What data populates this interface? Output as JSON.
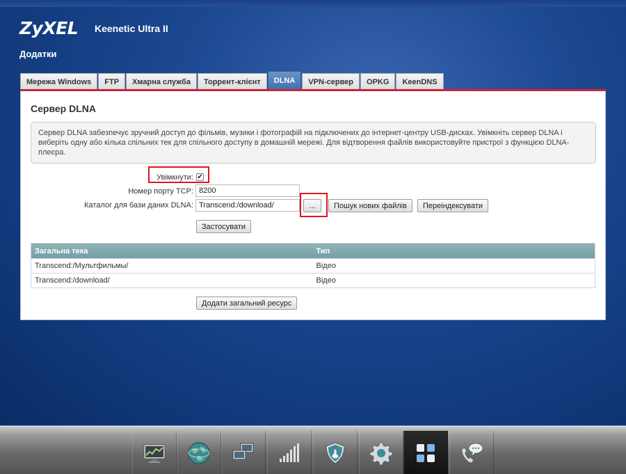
{
  "header": {
    "brand": "ZyXEL",
    "model": "Keenetic Ultra II",
    "section": "Додатки"
  },
  "tabs": [
    {
      "label": "Мережа Windows",
      "active": false
    },
    {
      "label": "FTP",
      "active": false
    },
    {
      "label": "Хмарна служба",
      "active": false
    },
    {
      "label": "Торрент-клієнт",
      "active": false
    },
    {
      "label": "DLNA",
      "active": true
    },
    {
      "label": "VPN-сервер",
      "active": false
    },
    {
      "label": "OPKG",
      "active": false
    },
    {
      "label": "KeenDNS",
      "active": false
    }
  ],
  "panel": {
    "title": "Сервер DLNA",
    "info": "Сервер DLNA забезпечує зручний доступ до фільмів, музики і фотографій на підключених до інтернет-центру USB-дисках. Увімкніть сервер DLNA і виберіть одну або кілька спільних тек для спільного доступу в домашній мережі. Для відтворення файлів використовуйте пристрої з функцією DLNA-плеєра."
  },
  "form": {
    "enable_label": "Увімкнути:",
    "enable_checked": true,
    "port_label": "Номер порту TCP:",
    "port_value": "8200",
    "db_label": "Каталог для бази даних DLNA:",
    "db_value": "Transcend:/download/",
    "browse_label": "...",
    "scan_label": "Пошук нових файлів",
    "reindex_label": "Переіндексувати",
    "apply_label": "Застосувати"
  },
  "shares": {
    "columns": [
      "Загальна тека",
      "Тип"
    ],
    "rows": [
      [
        "Transcend:/Мультфильмы/",
        "Відео"
      ],
      [
        "Transcend:/download/",
        "Відео"
      ]
    ],
    "add_label": "Додати загальний ресурс"
  },
  "dock": {
    "items": [
      {
        "icon": "monitor-chart-icon",
        "active": false
      },
      {
        "icon": "globe-icon",
        "active": false
      },
      {
        "icon": "network-computers-icon",
        "active": false
      },
      {
        "icon": "signal-bars-icon",
        "active": false
      },
      {
        "icon": "shield-icon",
        "active": false
      },
      {
        "icon": "gear-icon",
        "active": false
      },
      {
        "icon": "apps-grid-icon",
        "active": true
      },
      {
        "icon": "phone-chat-icon",
        "active": false
      }
    ]
  },
  "colors": {
    "accent_red": "#c8263a",
    "highlight": "#e0141e",
    "tab_active": "#4f7fbd",
    "table_header": "#7fa9ac"
  }
}
